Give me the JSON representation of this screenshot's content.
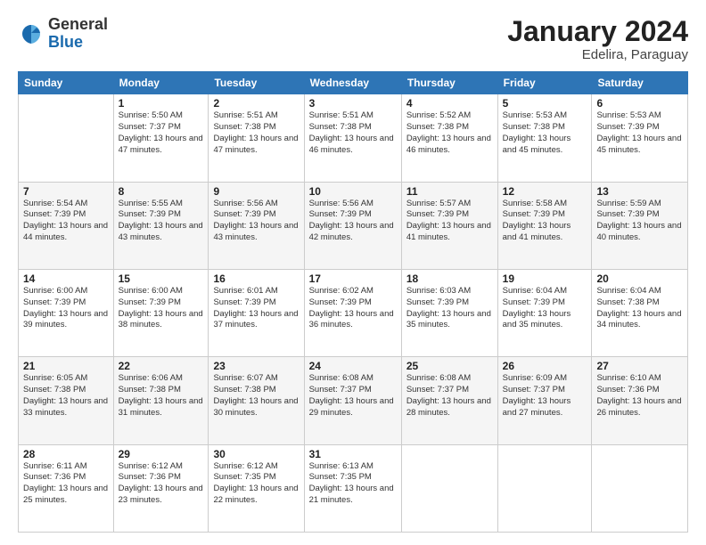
{
  "logo": {
    "general": "General",
    "blue": "Blue"
  },
  "header": {
    "month": "January 2024",
    "location": "Edelira, Paraguay"
  },
  "weekdays": [
    "Sunday",
    "Monday",
    "Tuesday",
    "Wednesday",
    "Thursday",
    "Friday",
    "Saturday"
  ],
  "weeks": [
    [
      {
        "day": "",
        "sunrise": "",
        "sunset": "",
        "daylight": ""
      },
      {
        "day": "1",
        "sunrise": "Sunrise: 5:50 AM",
        "sunset": "Sunset: 7:37 PM",
        "daylight": "Daylight: 13 hours and 47 minutes."
      },
      {
        "day": "2",
        "sunrise": "Sunrise: 5:51 AM",
        "sunset": "Sunset: 7:38 PM",
        "daylight": "Daylight: 13 hours and 47 minutes."
      },
      {
        "day": "3",
        "sunrise": "Sunrise: 5:51 AM",
        "sunset": "Sunset: 7:38 PM",
        "daylight": "Daylight: 13 hours and 46 minutes."
      },
      {
        "day": "4",
        "sunrise": "Sunrise: 5:52 AM",
        "sunset": "Sunset: 7:38 PM",
        "daylight": "Daylight: 13 hours and 46 minutes."
      },
      {
        "day": "5",
        "sunrise": "Sunrise: 5:53 AM",
        "sunset": "Sunset: 7:38 PM",
        "daylight": "Daylight: 13 hours and 45 minutes."
      },
      {
        "day": "6",
        "sunrise": "Sunrise: 5:53 AM",
        "sunset": "Sunset: 7:39 PM",
        "daylight": "Daylight: 13 hours and 45 minutes."
      }
    ],
    [
      {
        "day": "7",
        "sunrise": "Sunrise: 5:54 AM",
        "sunset": "Sunset: 7:39 PM",
        "daylight": "Daylight: 13 hours and 44 minutes."
      },
      {
        "day": "8",
        "sunrise": "Sunrise: 5:55 AM",
        "sunset": "Sunset: 7:39 PM",
        "daylight": "Daylight: 13 hours and 43 minutes."
      },
      {
        "day": "9",
        "sunrise": "Sunrise: 5:56 AM",
        "sunset": "Sunset: 7:39 PM",
        "daylight": "Daylight: 13 hours and 43 minutes."
      },
      {
        "day": "10",
        "sunrise": "Sunrise: 5:56 AM",
        "sunset": "Sunset: 7:39 PM",
        "daylight": "Daylight: 13 hours and 42 minutes."
      },
      {
        "day": "11",
        "sunrise": "Sunrise: 5:57 AM",
        "sunset": "Sunset: 7:39 PM",
        "daylight": "Daylight: 13 hours and 41 minutes."
      },
      {
        "day": "12",
        "sunrise": "Sunrise: 5:58 AM",
        "sunset": "Sunset: 7:39 PM",
        "daylight": "Daylight: 13 hours and 41 minutes."
      },
      {
        "day": "13",
        "sunrise": "Sunrise: 5:59 AM",
        "sunset": "Sunset: 7:39 PM",
        "daylight": "Daylight: 13 hours and 40 minutes."
      }
    ],
    [
      {
        "day": "14",
        "sunrise": "Sunrise: 6:00 AM",
        "sunset": "Sunset: 7:39 PM",
        "daylight": "Daylight: 13 hours and 39 minutes."
      },
      {
        "day": "15",
        "sunrise": "Sunrise: 6:00 AM",
        "sunset": "Sunset: 7:39 PM",
        "daylight": "Daylight: 13 hours and 38 minutes."
      },
      {
        "day": "16",
        "sunrise": "Sunrise: 6:01 AM",
        "sunset": "Sunset: 7:39 PM",
        "daylight": "Daylight: 13 hours and 37 minutes."
      },
      {
        "day": "17",
        "sunrise": "Sunrise: 6:02 AM",
        "sunset": "Sunset: 7:39 PM",
        "daylight": "Daylight: 13 hours and 36 minutes."
      },
      {
        "day": "18",
        "sunrise": "Sunrise: 6:03 AM",
        "sunset": "Sunset: 7:39 PM",
        "daylight": "Daylight: 13 hours and 35 minutes."
      },
      {
        "day": "19",
        "sunrise": "Sunrise: 6:04 AM",
        "sunset": "Sunset: 7:39 PM",
        "daylight": "Daylight: 13 hours and 35 minutes."
      },
      {
        "day": "20",
        "sunrise": "Sunrise: 6:04 AM",
        "sunset": "Sunset: 7:38 PM",
        "daylight": "Daylight: 13 hours and 34 minutes."
      }
    ],
    [
      {
        "day": "21",
        "sunrise": "Sunrise: 6:05 AM",
        "sunset": "Sunset: 7:38 PM",
        "daylight": "Daylight: 13 hours and 33 minutes."
      },
      {
        "day": "22",
        "sunrise": "Sunrise: 6:06 AM",
        "sunset": "Sunset: 7:38 PM",
        "daylight": "Daylight: 13 hours and 31 minutes."
      },
      {
        "day": "23",
        "sunrise": "Sunrise: 6:07 AM",
        "sunset": "Sunset: 7:38 PM",
        "daylight": "Daylight: 13 hours and 30 minutes."
      },
      {
        "day": "24",
        "sunrise": "Sunrise: 6:08 AM",
        "sunset": "Sunset: 7:37 PM",
        "daylight": "Daylight: 13 hours and 29 minutes."
      },
      {
        "day": "25",
        "sunrise": "Sunrise: 6:08 AM",
        "sunset": "Sunset: 7:37 PM",
        "daylight": "Daylight: 13 hours and 28 minutes."
      },
      {
        "day": "26",
        "sunrise": "Sunrise: 6:09 AM",
        "sunset": "Sunset: 7:37 PM",
        "daylight": "Daylight: 13 hours and 27 minutes."
      },
      {
        "day": "27",
        "sunrise": "Sunrise: 6:10 AM",
        "sunset": "Sunset: 7:36 PM",
        "daylight": "Daylight: 13 hours and 26 minutes."
      }
    ],
    [
      {
        "day": "28",
        "sunrise": "Sunrise: 6:11 AM",
        "sunset": "Sunset: 7:36 PM",
        "daylight": "Daylight: 13 hours and 25 minutes."
      },
      {
        "day": "29",
        "sunrise": "Sunrise: 6:12 AM",
        "sunset": "Sunset: 7:36 PM",
        "daylight": "Daylight: 13 hours and 23 minutes."
      },
      {
        "day": "30",
        "sunrise": "Sunrise: 6:12 AM",
        "sunset": "Sunset: 7:35 PM",
        "daylight": "Daylight: 13 hours and 22 minutes."
      },
      {
        "day": "31",
        "sunrise": "Sunrise: 6:13 AM",
        "sunset": "Sunset: 7:35 PM",
        "daylight": "Daylight: 13 hours and 21 minutes."
      },
      {
        "day": "",
        "sunrise": "",
        "sunset": "",
        "daylight": ""
      },
      {
        "day": "",
        "sunrise": "",
        "sunset": "",
        "daylight": ""
      },
      {
        "day": "",
        "sunrise": "",
        "sunset": "",
        "daylight": ""
      }
    ]
  ]
}
